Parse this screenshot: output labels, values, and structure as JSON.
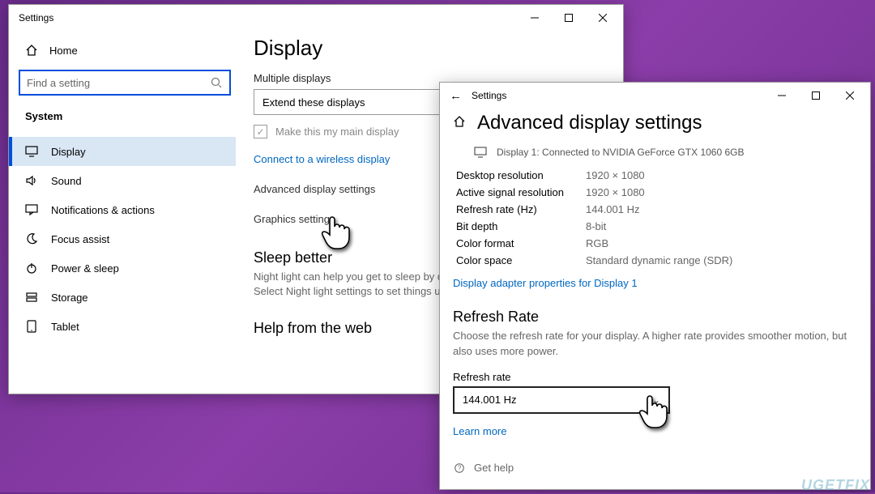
{
  "back_window": {
    "title": "Settings",
    "home_label": "Home",
    "search_placeholder": "Find a setting",
    "section_label": "System",
    "nav": [
      {
        "label": "Display",
        "icon": "monitor-icon",
        "active": true
      },
      {
        "label": "Sound",
        "icon": "speaker-icon"
      },
      {
        "label": "Notifications & actions",
        "icon": "message-icon"
      },
      {
        "label": "Focus assist",
        "icon": "moon-icon"
      },
      {
        "label": "Power & sleep",
        "icon": "power-icon"
      },
      {
        "label": "Storage",
        "icon": "storage-icon"
      },
      {
        "label": "Tablet",
        "icon": "tablet-icon"
      }
    ],
    "main": {
      "heading": "Display",
      "multiple_displays_label": "Multiple displays",
      "multiple_displays_value": "Extend these displays",
      "main_display_checkbox": "Make this my main display",
      "connect_wireless": "Connect to a wireless display",
      "advanced_link": "Advanced display settings",
      "graphics_link": "Graphics settings",
      "sleep_heading": "Sleep better",
      "sleep_body": "Night light can help you get to sleep by displaying warmer colors at night. Select Night light settings to set things up.",
      "help_heading": "Help from the web"
    }
  },
  "front_window": {
    "title": "Settings",
    "heading": "Advanced display settings",
    "display_info": "Display 1: Connected to NVIDIA GeForce GTX 1060 6GB",
    "rows": {
      "desktop_res_k": "Desktop resolution",
      "desktop_res_v": "1920 × 1080",
      "active_res_k": "Active signal resolution",
      "active_res_v": "1920 × 1080",
      "refresh_k": "Refresh rate (Hz)",
      "refresh_v": "144.001 Hz",
      "bitdepth_k": "Bit depth",
      "bitdepth_v": "8-bit",
      "colorfmt_k": "Color format",
      "colorfmt_v": "RGB",
      "colorspace_k": "Color space",
      "colorspace_v": "Standard dynamic range (SDR)"
    },
    "adapter_link": "Display adapter properties for Display 1",
    "refresh_heading": "Refresh Rate",
    "refresh_body": "Choose the refresh rate for your display. A higher rate provides smoother motion, but also uses more power.",
    "refresh_label": "Refresh rate",
    "refresh_value": "144.001 Hz",
    "learn_more": "Learn more",
    "get_help": "Get help"
  },
  "watermark": "UGETFIX"
}
